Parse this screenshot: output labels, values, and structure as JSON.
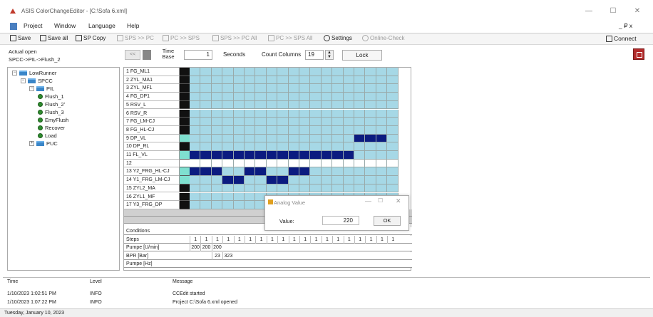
{
  "window": {
    "title": "ASIS ColorChangeEditor - [C:\\Sofa 6.xml]",
    "min": "—",
    "max": "☐",
    "close": "✕"
  },
  "menu": [
    "Project",
    "Window",
    "Language",
    "Help"
  ],
  "menu_right": "_ ₽ x",
  "toolbar": [
    {
      "label": "Save",
      "icon": "save-icon",
      "enabled": true
    },
    {
      "label": "Save all",
      "icon": "save-all-icon",
      "enabled": true
    },
    {
      "label": "SP Copy",
      "icon": "sp-copy-icon",
      "enabled": true
    },
    {
      "label": "SPS >> PC",
      "icon": "download-icon",
      "enabled": false
    },
    {
      "label": "PC >> SPS",
      "icon": "upload-icon",
      "enabled": false
    },
    {
      "label": "SPS >> PC All",
      "icon": "download-all-icon",
      "enabled": false
    },
    {
      "label": "PC >> SPS All",
      "icon": "upload-all-icon",
      "enabled": false
    },
    {
      "label": "Settings",
      "icon": "gear-icon",
      "enabled": true
    },
    {
      "label": "Online-Check",
      "icon": "refresh-icon",
      "enabled": false
    }
  ],
  "connect_label": "Connect",
  "actual_open": {
    "label": "Actual open",
    "path": "SPCC->PIL->Flush_2"
  },
  "time_box": "<<",
  "time_base": {
    "label1": "Time",
    "label2": "Base",
    "value": "1",
    "unit": "Seconds"
  },
  "count_columns": {
    "label": "Count Columns",
    "value": "19"
  },
  "lock_label": "Lock",
  "tree": [
    {
      "label": "LowRunner",
      "type": "folder",
      "level": 0,
      "expand": "−"
    },
    {
      "label": "SPCC",
      "type": "folder",
      "level": 1,
      "expand": "−"
    },
    {
      "label": "PIL",
      "type": "folder",
      "level": 2,
      "expand": "−"
    },
    {
      "label": "Flush_1",
      "type": "leaf",
      "level": 3
    },
    {
      "label": "Flush_2'",
      "type": "leaf",
      "level": 3
    },
    {
      "label": "Flush_3",
      "type": "leaf",
      "level": 3
    },
    {
      "label": "EmyFlush",
      "type": "leaf",
      "level": 3
    },
    {
      "label": "Recover",
      "type": "leaf",
      "level": 3
    },
    {
      "label": "Load",
      "type": "leaf",
      "level": 3
    },
    {
      "label": "PUC",
      "type": "folder",
      "level": 2,
      "expand": "+"
    }
  ],
  "grid": {
    "columns": 19,
    "rows": [
      {
        "label": "1 FG_ML1",
        "marker": "black",
        "on": []
      },
      {
        "label": "2 ZYL_MA1",
        "marker": "black",
        "on": []
      },
      {
        "label": "3 ZYL_MF1",
        "marker": "black",
        "on": []
      },
      {
        "label": "4 FG_DP1",
        "marker": "black",
        "on": []
      },
      {
        "label": "5 RSV_L",
        "marker": "black",
        "on": []
      },
      {
        "label": "6 RSV_R",
        "marker": "black",
        "on": []
      },
      {
        "label": "7 FG_LM-CJ",
        "marker": "black",
        "on": []
      },
      {
        "label": "8 FG_HL-CJ",
        "marker": "black",
        "on": []
      },
      {
        "label": "9 DP_VL",
        "marker": "teal",
        "on": [
          15,
          16,
          17
        ]
      },
      {
        "label": "10 DP_RL",
        "marker": "black",
        "on": []
      },
      {
        "label": "11 FL_VL",
        "marker": "teal",
        "on": [
          0,
          1,
          2,
          3,
          4,
          5,
          6,
          7,
          8,
          9,
          10,
          11,
          12,
          13,
          14
        ]
      },
      {
        "label": "12",
        "marker": "white",
        "on": [],
        "blank": true
      },
      {
        "label": "13 Y2_FRG_HL-CJ",
        "marker": "teal",
        "on": [
          0,
          1,
          2,
          5,
          6,
          9,
          10
        ]
      },
      {
        "label": "14 Y1_FRG_LM-CJ",
        "marker": "teal",
        "on": [
          3,
          4,
          7,
          8
        ]
      },
      {
        "label": "15 ZYL2_MA",
        "marker": "black",
        "on": []
      },
      {
        "label": "16 ZYL1_MF",
        "marker": "black",
        "on": []
      },
      {
        "label": "17 Y3_FRG_DP",
        "marker": "black",
        "on": []
      }
    ],
    "bottom": [
      {
        "label": "Conditions",
        "values": []
      },
      {
        "label": "Steps",
        "values": [
          "1",
          "1",
          "1",
          "1",
          "1",
          "1",
          "1",
          "1",
          "1",
          "1",
          "1",
          "1",
          "1",
          "1",
          "1",
          "1",
          "1",
          "1",
          "1"
        ]
      },
      {
        "label": "Pumpe [U/min]",
        "values": [
          "200",
          "200",
          "200"
        ]
      },
      {
        "label": "BPR [Bar]",
        "values": [
          "",
          "",
          "23",
          "323"
        ]
      },
      {
        "label": "Pumpe [Hz]",
        "values": []
      }
    ]
  },
  "dialog": {
    "title": "Analog Value",
    "min": "—",
    "max": "☐",
    "close": "✕",
    "label": "Value:",
    "value": "220",
    "ok": "OK"
  },
  "log": {
    "headers": {
      "time": "Time",
      "level": "Level",
      "message": "Message"
    },
    "entries": [
      {
        "time": "1/10/2023 1:02:51 PM",
        "level": "INFO",
        "message": "CCEdit started"
      },
      {
        "time": "1/10/2023 1:07:22 PM",
        "level": "INFO",
        "message": "Project C:\\Sofa 6.xml opened"
      }
    ]
  },
  "status": "Tuesday, January 10, 2023",
  "colors": {
    "cell": "#a6d8e6",
    "on": "#0b1b80",
    "teal": "#7fe0d0",
    "black": "#111111"
  }
}
